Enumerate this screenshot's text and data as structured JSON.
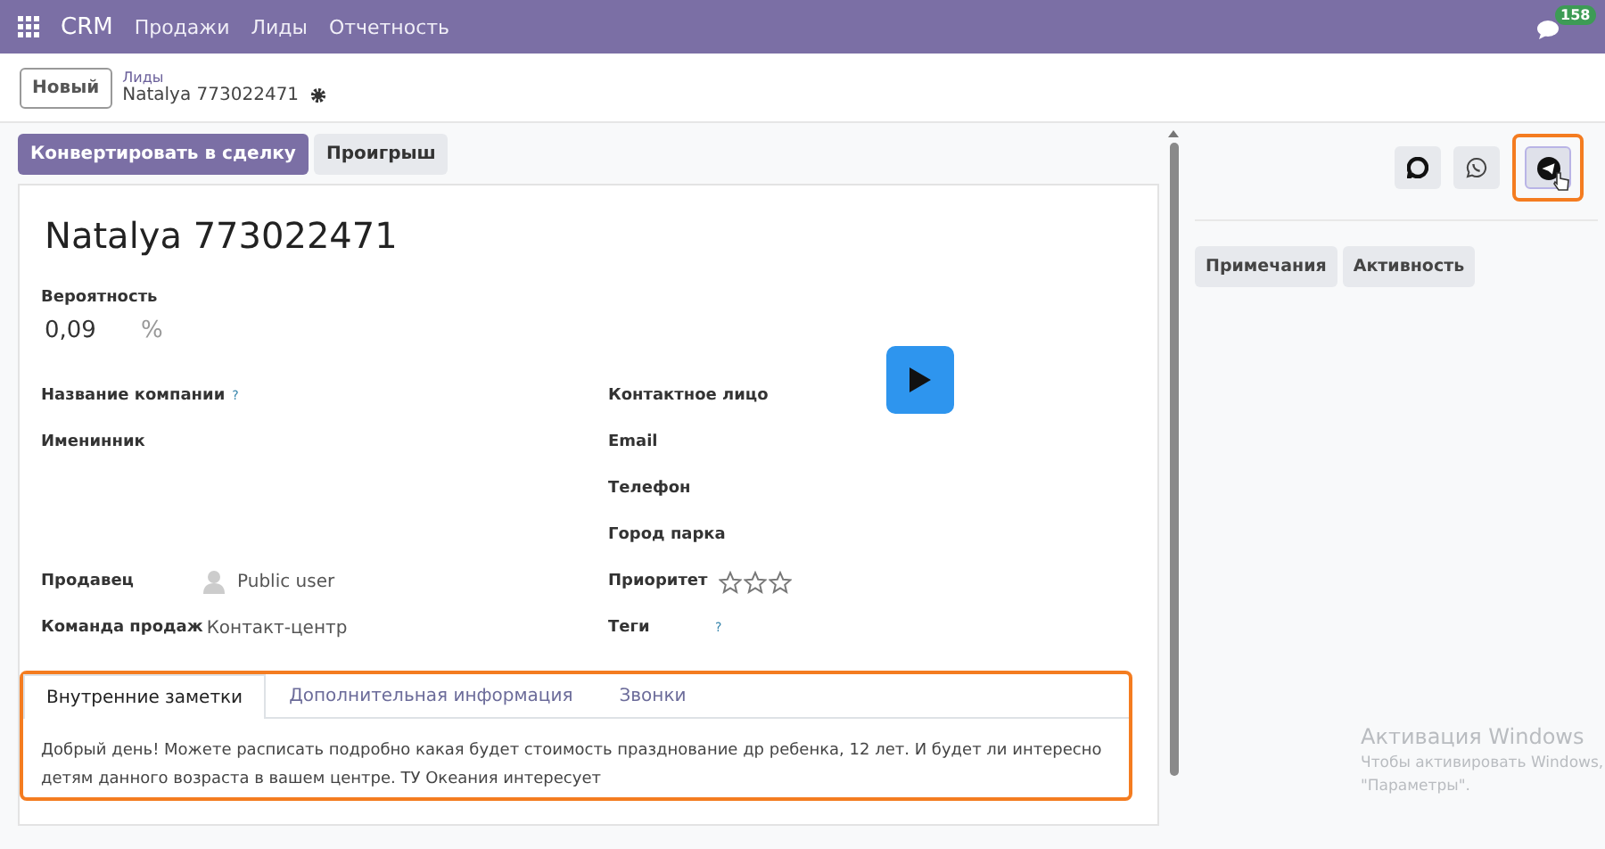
{
  "navbar": {
    "app": "CRM",
    "menu": [
      "Продажи",
      "Лиды",
      "Отчетность"
    ],
    "messages_badge": "158"
  },
  "control_panel": {
    "new_button": "Новый",
    "breadcrumb": "Лиды",
    "record_name": "Natalya 773022471"
  },
  "statusbar_buttons": [
    {
      "label": "Конвертировать в сделку",
      "primary": true
    },
    {
      "label": "Проигрыш",
      "primary": false
    }
  ],
  "form": {
    "title": "Natalya 773022471",
    "probability_label": "Вероятность",
    "probability_value": "0,09",
    "probability_unit": "%",
    "left_fields": [
      {
        "label": "Название компании",
        "hint": "?"
      },
      {
        "label": "Именинник"
      },
      {
        "label": "Продавец",
        "value": "Public user",
        "kind": "user"
      },
      {
        "label": "Команда продаж",
        "value": "Контакт-центр"
      }
    ],
    "right_fields": [
      {
        "label": "Контактное лицо",
        "kind": "text"
      },
      {
        "label": "Email",
        "kind": "text"
      },
      {
        "label": "Телефон",
        "kind": "text"
      },
      {
        "label": "Город парка",
        "kind": "text"
      },
      {
        "label": "Приоритет",
        "kind": "stars",
        "stars": 0
      },
      {
        "label": "Теги",
        "kind": "text",
        "hint": "?"
      }
    ],
    "notebook": {
      "tabs": [
        {
          "label": "Внутренние заметки",
          "selected": true
        },
        {
          "label": "Дополнительная информация",
          "selected": false
        },
        {
          "label": "Звонки",
          "selected": false
        }
      ],
      "note": "Добрый день! Можете расписать подробно какая будет стоимость празднование др ребенка, 12 лет. И будет ли интересно детям данного возраста в вашем центре. ТУ Океания интересует",
      "highlighted": true
    }
  },
  "chatter": {
    "channel_buttons": [
      {
        "kind": "chat",
        "active": false,
        "highlighted": false
      },
      {
        "kind": "whatsapp",
        "active": false,
        "highlighted": false
      },
      {
        "kind": "telegram",
        "active": true,
        "highlighted": true
      }
    ],
    "tabs": [
      "Примечания",
      "Активность"
    ]
  },
  "windows_activation": {
    "title": "Активация Windows",
    "line_1": "Чтобы активировать Windows,",
    "line_2": "\"Параметры\"."
  }
}
